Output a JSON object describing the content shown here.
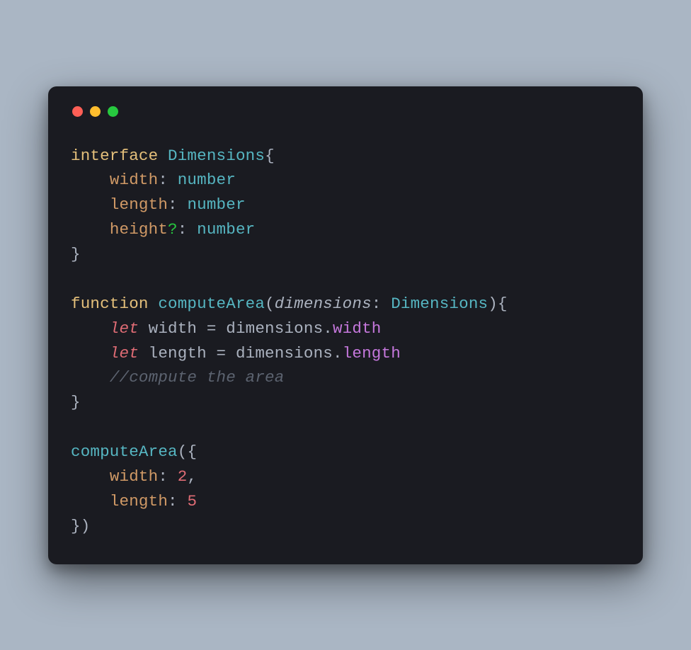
{
  "tokens": {
    "interface": "interface",
    "dimensionsType": "Dimensions",
    "width": "width",
    "length": "length",
    "height": "height",
    "optional": "?",
    "number": "number",
    "function": "function",
    "computeArea": "computeArea",
    "dimensionsParam": "dimensions",
    "let": "let",
    "dot": ".",
    "comment": "//compute the area",
    "two": "2",
    "five": "5",
    "colon": ":",
    "comma": ",",
    "equals": "=",
    "openBrace": "{",
    "closeBrace": "}",
    "openParen": "(",
    "closeParen": ")",
    "space": " "
  }
}
